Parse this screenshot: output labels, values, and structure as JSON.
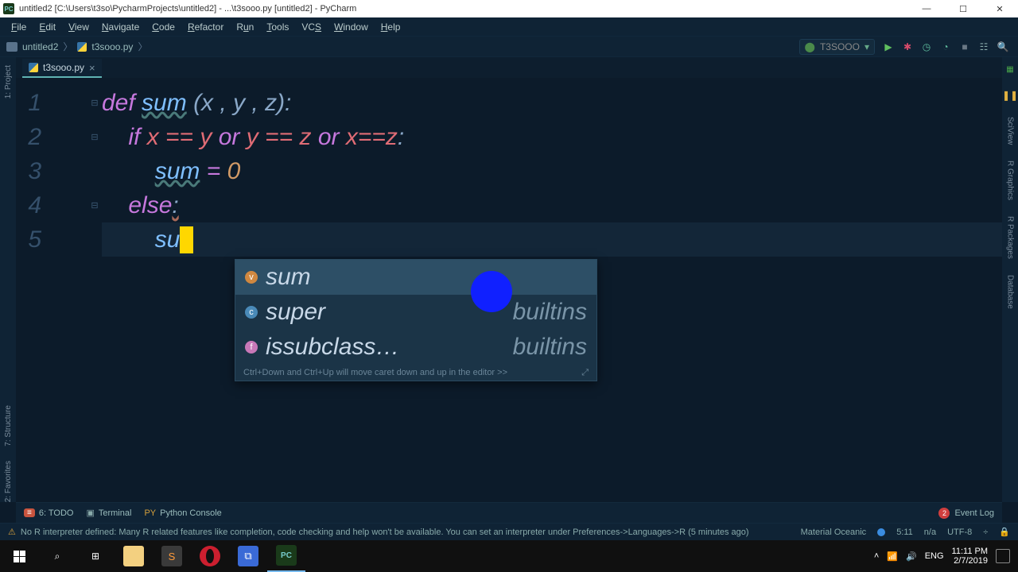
{
  "titlebar": {
    "text": "untitled2 [C:\\Users\\t3so\\PycharmProjects\\untitled2] - ...\\t3sooo.py [untitled2] - PyCharm"
  },
  "menu": [
    "File",
    "Edit",
    "View",
    "Navigate",
    "Code",
    "Refactor",
    "Run",
    "Tools",
    "VCS",
    "Window",
    "Help"
  ],
  "breadcrumb": {
    "project": "untitled2",
    "file": "t3sooo.py"
  },
  "runconfig": "T3SOOO",
  "tab": {
    "name": "t3sooo.py"
  },
  "left_tools": [
    "1: Project",
    "7: Structure",
    "2: Favorites"
  ],
  "right_tools": [
    "SciView",
    "R Graphics",
    "R Packages",
    "Database"
  ],
  "lines": [
    "1",
    "2",
    "3",
    "4",
    "5"
  ],
  "code": {
    "l1": {
      "a": "def ",
      "b": "sum",
      "c": " (x , y , z):"
    },
    "l2": {
      "a": "    if ",
      "b": "x == y",
      "c": " or ",
      "d": "y == z",
      "e": " or ",
      "f": "x==z",
      ":": ":"
    },
    "l3": {
      "a": "        ",
      "b": "sum",
      "c": " = ",
      "d": "0"
    },
    "l4": {
      "a": "    else",
      ":": ":"
    },
    "l5": {
      "a": "        su"
    }
  },
  "completion": {
    "items": [
      {
        "label": "sum",
        "hint": ""
      },
      {
        "label": "super",
        "hint": "builtins"
      },
      {
        "label": "issubclass…",
        "hint": "builtins"
      }
    ],
    "footer": "Ctrl+Down and Ctrl+Up will move caret down and up in the editor  >>"
  },
  "bottom_tools": {
    "todo": "6: TODO",
    "terminal": "Terminal",
    "console": "Python Console",
    "event": "Event Log"
  },
  "status": {
    "msg": "No R interpreter defined: Many R related features like completion, code checking and help won't be available. You can set an interpreter under Preferences->Languages->R (5 minutes ago)",
    "theme": "Material Oceanic",
    "pos": "5:11",
    "sel": "n/a",
    "enc": "UTF-8",
    "lock": "🔒"
  },
  "tray": {
    "lang": "ENG",
    "time": "11:11 PM",
    "date": "2/7/2019"
  }
}
